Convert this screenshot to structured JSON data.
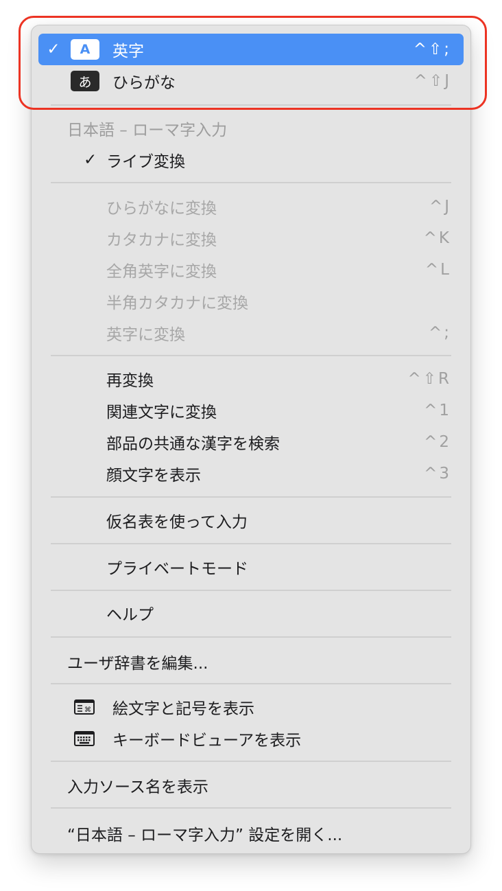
{
  "input_modes": [
    {
      "label": "英字",
      "badge": "A",
      "shortcut": "^⇧;",
      "checked": true
    },
    {
      "label": "ひらがな",
      "badge": "あ",
      "shortcut": "^⇧J",
      "checked": false
    }
  ],
  "section_header": "日本語 – ローマ字入力",
  "live_conversion": {
    "check": "✓",
    "label": "ライブ変換"
  },
  "convert_items": [
    {
      "label": "ひらがなに変換",
      "shortcut": "^J"
    },
    {
      "label": "カタカナに変換",
      "shortcut": "^K"
    },
    {
      "label": "全角英字に変換",
      "shortcut": "^L"
    },
    {
      "label": "半角カタカナに変換",
      "shortcut": ""
    },
    {
      "label": "英字に変換",
      "shortcut": "^;"
    }
  ],
  "reconvert_items": [
    {
      "label": "再変換",
      "shortcut": "^⇧R"
    },
    {
      "label": "関連文字に変換",
      "shortcut": "^1"
    },
    {
      "label": "部品の共通な漢字を検索",
      "shortcut": "^2"
    },
    {
      "label": "顔文字を表示",
      "shortcut": "^3"
    }
  ],
  "kana_table": "仮名表を使って入力",
  "private_mode": "プライベートモード",
  "help": "ヘルプ",
  "edit_dictionary": "ユーザ辞書を編集...",
  "viewers": [
    {
      "label": "絵文字と記号を表示",
      "icon": "emoji-viewer-icon"
    },
    {
      "label": "キーボードビューアを表示",
      "icon": "keyboard-icon"
    }
  ],
  "show_input_source_name": "入力ソース名を表示",
  "open_settings": "“日本語 – ローマ字入力” 設定を開く...",
  "colors": {
    "selection": "#4a90f5",
    "ring": "#ec3323",
    "menu_bg": "#e4e4e4"
  }
}
